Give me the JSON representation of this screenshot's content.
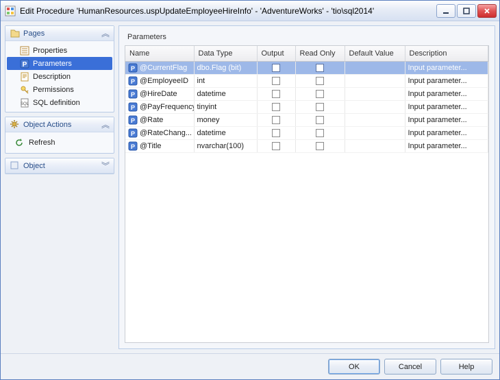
{
  "window": {
    "title": "Edit Procedure 'HumanResources.uspUpdateEmployeeHireInfo' - 'AdventureWorks' - 'tio\\sql2014'"
  },
  "sidebar": {
    "pages": {
      "label": "Pages",
      "items": [
        {
          "label": "Properties",
          "selected": false
        },
        {
          "label": "Parameters",
          "selected": true
        },
        {
          "label": "Description",
          "selected": false
        },
        {
          "label": "Permissions",
          "selected": false
        },
        {
          "label": "SQL definition",
          "selected": false
        }
      ]
    },
    "actions": {
      "label": "Object Actions",
      "items": [
        {
          "label": "Refresh"
        }
      ]
    },
    "object": {
      "label": "Object",
      "collapsed": true
    }
  },
  "main": {
    "section_title": "Parameters",
    "columns": {
      "name": "Name",
      "datatype": "Data Type",
      "output": "Output",
      "readonly": "Read Only",
      "defaultvalue": "Default Value",
      "description": "Description"
    },
    "rows": [
      {
        "name": "@CurrentFlag",
        "datatype": "dbo.Flag (bit)",
        "output": false,
        "readonly": false,
        "default": "",
        "desc": "Input parameter...",
        "selected": true
      },
      {
        "name": "@EmployeeID",
        "datatype": "int",
        "output": false,
        "readonly": false,
        "default": "",
        "desc": "Input parameter...",
        "selected": false
      },
      {
        "name": "@HireDate",
        "datatype": "datetime",
        "output": false,
        "readonly": false,
        "default": "",
        "desc": "Input parameter...",
        "selected": false
      },
      {
        "name": "@PayFrequency",
        "datatype": "tinyint",
        "output": false,
        "readonly": false,
        "default": "",
        "desc": "Input parameter...",
        "selected": false
      },
      {
        "name": "@Rate",
        "datatype": "money",
        "output": false,
        "readonly": false,
        "default": "",
        "desc": "Input parameter...",
        "selected": false
      },
      {
        "name": "@RateChang...",
        "datatype": "datetime",
        "output": false,
        "readonly": false,
        "default": "",
        "desc": "Input parameter...",
        "selected": false
      },
      {
        "name": "@Title",
        "datatype": "nvarchar(100)",
        "output": false,
        "readonly": false,
        "default": "",
        "desc": "Input parameter...",
        "selected": false
      }
    ]
  },
  "footer": {
    "ok": "OK",
    "cancel": "Cancel",
    "help": "Help"
  }
}
